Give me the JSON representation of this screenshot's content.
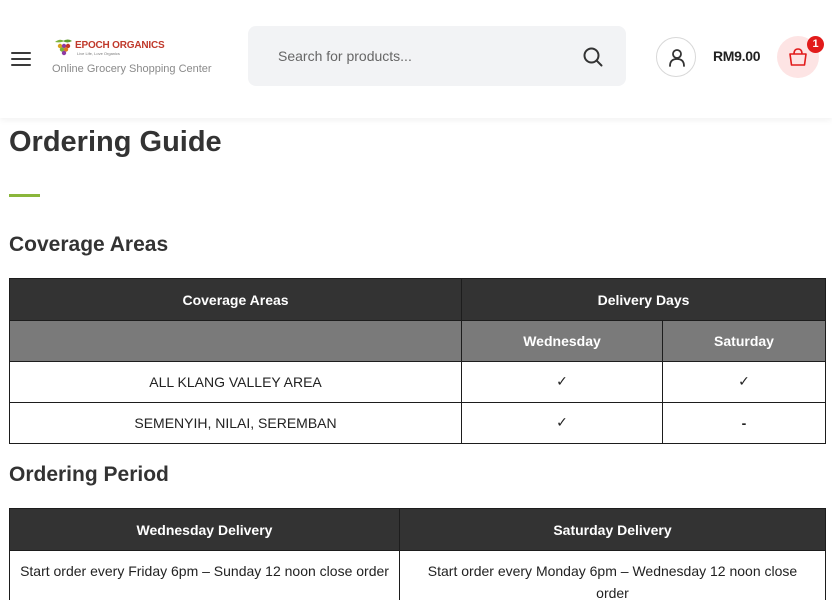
{
  "header": {
    "brand_name": "EPOCH ORGANICS",
    "brand_tagline": "Live Life, Love Organics",
    "brand_subtitle": "Online Grocery Shopping Center",
    "search_placeholder": "Search for products...",
    "cart_total": "RM9.00",
    "cart_count": "1",
    "colors": {
      "brand_red": "#c0392b",
      "badge_red": "#e21b1b",
      "cart_bg": "#fde4e4",
      "search_bg": "#f2f3f5"
    }
  },
  "page": {
    "title": "Ordering Guide",
    "accent_color": "#8ab63b"
  },
  "coverage": {
    "heading": "Coverage Areas",
    "col_area": "Coverage Areas",
    "col_days": "Delivery Days",
    "day_wed": "Wednesday",
    "day_sat": "Saturday",
    "rows": [
      {
        "area": "ALL KLANG VALLEY AREA",
        "wed": "✓",
        "sat": "✓"
      },
      {
        "area": "SEMENYIH, NILAI, SEREMBAN",
        "wed": "✓",
        "sat": "-"
      }
    ]
  },
  "ordering": {
    "heading": "Ordering Period",
    "col_wed": "Wednesday Delivery",
    "col_sat": "Saturday Delivery",
    "wed_text": "Start order every Friday 6pm – Sunday 12 noon close order",
    "sat_text": "Start order every Monday 6pm – Wednesday 12 noon close order"
  }
}
